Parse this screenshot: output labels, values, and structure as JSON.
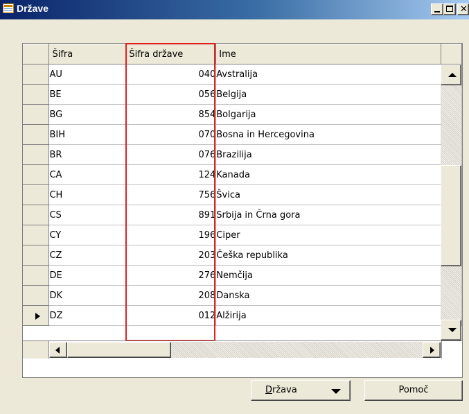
{
  "window": {
    "title": "Države"
  },
  "table": {
    "columns": [
      "Šifra",
      "Šifra države",
      "Ime"
    ],
    "rows": [
      {
        "code": "AU",
        "country_code": "040",
        "name": "Avstralija"
      },
      {
        "code": "BE",
        "country_code": "056",
        "name": "Belgija"
      },
      {
        "code": "BG",
        "country_code": "854",
        "name": "Bolgarija"
      },
      {
        "code": "BIH",
        "country_code": "070",
        "name": "Bosna in Hercegovina"
      },
      {
        "code": "BR",
        "country_code": "076",
        "name": "Brazilija"
      },
      {
        "code": "CA",
        "country_code": "124",
        "name": "Kanada"
      },
      {
        "code": "CH",
        "country_code": "756",
        "name": "Švica"
      },
      {
        "code": "CS",
        "country_code": "891",
        "name": "Srbija in Črna gora"
      },
      {
        "code": "CY",
        "country_code": "196",
        "name": "Ciper"
      },
      {
        "code": "CZ",
        "country_code": "203",
        "name": "Češka republika"
      },
      {
        "code": "DE",
        "country_code": "276",
        "name": "Nemčija"
      },
      {
        "code": "DK",
        "country_code": "208",
        "name": "Danska"
      },
      {
        "code": "DZ",
        "country_code": "012",
        "name": "Alžirija"
      }
    ]
  },
  "buttons": {
    "drzava_first": "D",
    "drzava_rest": "ržava",
    "pomoc": "Pomoč"
  },
  "highlight_color": "#e02020"
}
